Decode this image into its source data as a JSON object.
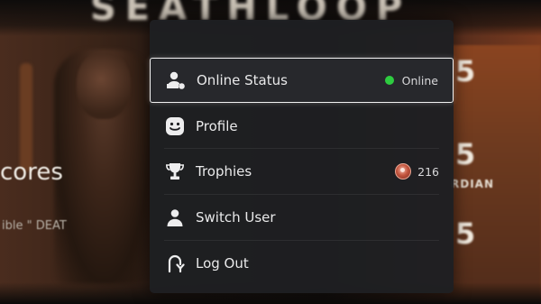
{
  "background": {
    "banner_text": "SEATHLOOP",
    "side_text": "cores",
    "side_subtext": "ible \" DEAT",
    "right_numbers": [
      "5",
      "5",
      "5"
    ],
    "right_label": "RDIAN"
  },
  "quick_menu": {
    "items": [
      {
        "label": "Online Status",
        "icon": "user-status-icon",
        "status_text": "Online",
        "status_color": "#2ecc40",
        "selected": true
      },
      {
        "label": "Profile",
        "icon": "smiley-face-icon"
      },
      {
        "label": "Trophies",
        "icon": "trophy-icon",
        "trophy_count": "216"
      },
      {
        "label": "Switch User",
        "icon": "user-icon"
      },
      {
        "label": "Log Out",
        "icon": "log-out-icon"
      }
    ]
  }
}
